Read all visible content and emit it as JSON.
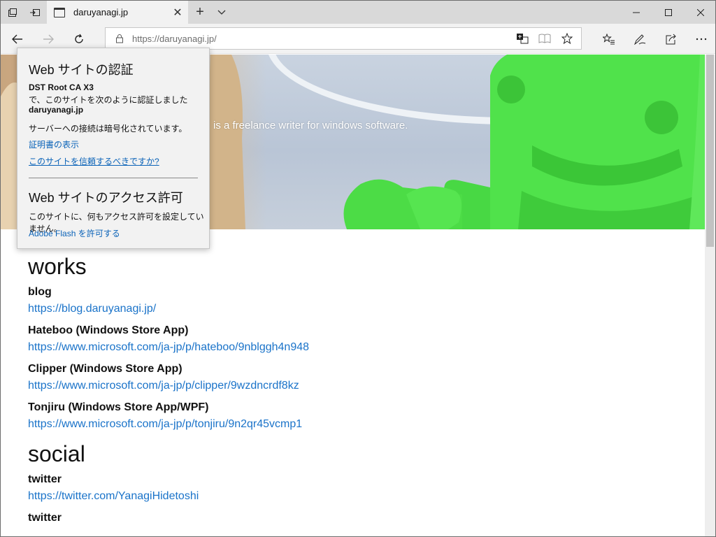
{
  "tab": {
    "title": "daruyanagi.jp"
  },
  "address": {
    "url": "https://daruyanagi.jp/"
  },
  "hero": {
    "tagline": "is a freelance writer for windows software."
  },
  "flyout": {
    "title": "Web サイトの認証",
    "ca_name": "DST Root CA X3",
    "ca_line": "で、このサイトを次のように認証しました",
    "domain": "daruyanagi.jp",
    "encrypted": "サーバーへの接続は暗号化されています。",
    "view_cert": "証明書の表示",
    "trust_question": "このサイトを信頼するべきですか?",
    "permissions_title": "Web サイトのアクセス許可",
    "permissions_text": "このサイトに、何もアクセス許可を設定していません。",
    "allow_flash": "Adobe Flash を許可する"
  },
  "works": {
    "title": "works",
    "items": [
      {
        "name": "blog",
        "link": "https://blog.daruyanagi.jp/"
      },
      {
        "name": "Hateboo (Windows Store App)",
        "link": "https://www.microsoft.com/ja-jp/p/hateboo/9nblggh4n948"
      },
      {
        "name": "Clipper (Windows Store App)",
        "link": "https://www.microsoft.com/ja-jp/p/clipper/9wzdncrdf8kz"
      },
      {
        "name": "Tonjiru (Windows Store App/WPF)",
        "link": "https://www.microsoft.com/ja-jp/p/tonjiru/9n2qr45vcmp1"
      }
    ]
  },
  "social": {
    "title": "social",
    "items": [
      {
        "name": "twitter",
        "link": "https://twitter.com/YanagiHidetoshi"
      },
      {
        "name": "twitter",
        "link": ""
      }
    ]
  },
  "colors": {
    "link": "#1a73c9",
    "tab_bar": "#d9d9d9",
    "toolbar": "#f2f2f2",
    "android_green": "#4fe04a"
  }
}
